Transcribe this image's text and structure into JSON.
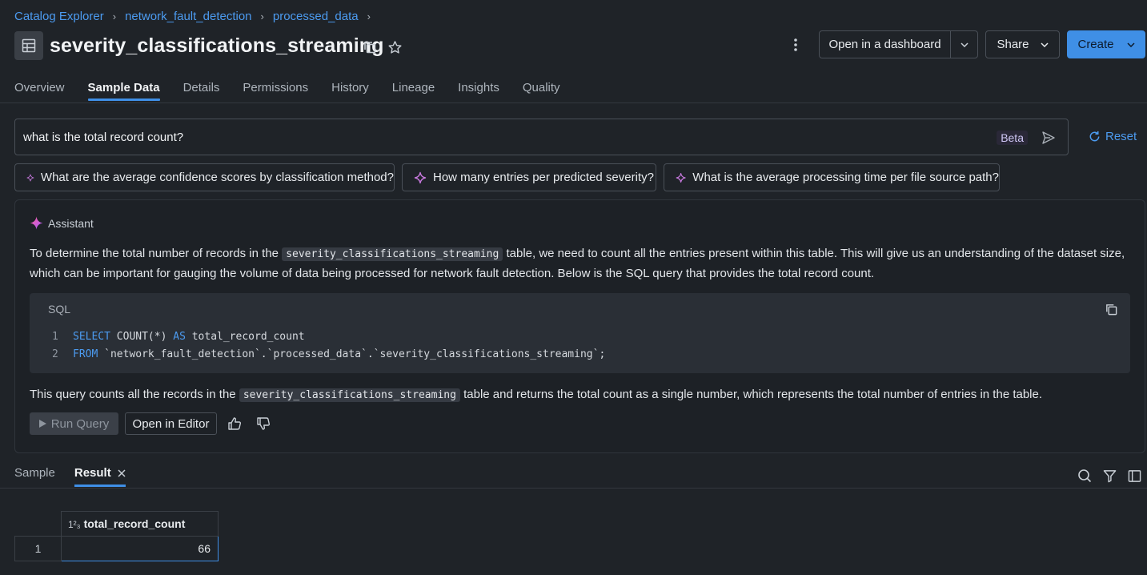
{
  "breadcrumb": [
    "Catalog Explorer",
    "network_fault_detection",
    "processed_data"
  ],
  "title": "severity_classifications_streaming",
  "header_buttons": {
    "dashboard": "Open in a dashboard",
    "share": "Share",
    "create": "Create"
  },
  "tabs": [
    {
      "label": "Overview",
      "active": false
    },
    {
      "label": "Sample Data",
      "active": true
    },
    {
      "label": "Details",
      "active": false
    },
    {
      "label": "Permissions",
      "active": false
    },
    {
      "label": "History",
      "active": false
    },
    {
      "label": "Lineage",
      "active": false
    },
    {
      "label": "Insights",
      "active": false
    },
    {
      "label": "Quality",
      "active": false
    }
  ],
  "prompt": {
    "value": "what is the total record count?",
    "badge": "Beta",
    "reset_label": "Reset"
  },
  "suggestions": [
    "What are the average confidence scores by classification method?",
    "How many entries per predicted severity?",
    "What is the average processing time per file source path?"
  ],
  "assistant": {
    "label": "Assistant",
    "intro_before": "To determine the total number of records in the",
    "intro_code": "severity_classifications_streaming",
    "intro_after": "table, we need to count all the entries present within this table. This will give us an understanding of the dataset size,",
    "intro_line2": "which can be important for gauging the volume of data being processed for network fault detection. Below is the SQL query that provides the total record count.",
    "code_lang": "SQL",
    "code_lines": [
      {
        "num": "1",
        "kw1": "SELECT",
        "mid": " COUNT(*) ",
        "kw2": "AS",
        "rest": " total_record_count"
      },
      {
        "num": "2",
        "kw1": "FROM",
        "mid": " `network_fault_detection`.`processed_data`.`severity_classifications_streaming`;",
        "kw2": "",
        "rest": ""
      }
    ],
    "outro_before": "This query counts all the records in the",
    "outro_code": "severity_classifications_streaming",
    "outro_after": "table and returns the total count as a single number, which represents the total number of entries in the table.",
    "run_label": "Run Query",
    "editor_label": "Open in Editor"
  },
  "result_tabs": [
    {
      "label": "Sample",
      "active": false
    },
    {
      "label": "Result",
      "active": true
    }
  ],
  "result": {
    "column_type": "1²₃",
    "column": "total_record_count",
    "rows": [
      {
        "num": "1",
        "value": "66"
      }
    ]
  },
  "colors": {
    "accent": "#3f8fe6",
    "link": "#4c9bf0",
    "background": "#1f2328"
  }
}
